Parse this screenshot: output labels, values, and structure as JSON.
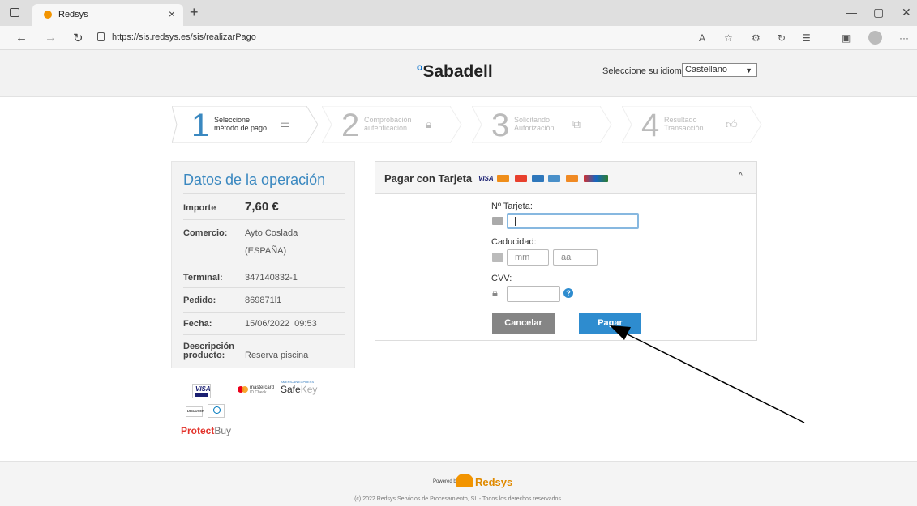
{
  "browser": {
    "tab_title": "Redsys",
    "tab_close": "×",
    "new_tab": "+",
    "url": "https://sis.redsys.es/sis/realizarPago",
    "read_aloud": "A̅",
    "window": {
      "minimize": "—",
      "restore": "▢",
      "close": "✕"
    }
  },
  "header": {
    "logo_mark": "o",
    "logo": "Sabadell",
    "language_label": "Seleccione su idioma",
    "language_value": "Castellano"
  },
  "steps": [
    {
      "number": "1",
      "line1": "Seleccione",
      "line2": "método de pago"
    },
    {
      "number": "2",
      "line1": "Comprobación",
      "line2": "autenticación"
    },
    {
      "number": "3",
      "line1": "Solicitando",
      "line2": "Autorización"
    },
    {
      "number": "4",
      "line1": "Resultado",
      "line2": "Transacción"
    }
  ],
  "operation": {
    "title": "Datos de la operación",
    "rows": [
      {
        "key": "Importe",
        "value": "7,60 €"
      },
      {
        "key": "Comercio:",
        "value": "Ayto Coslada",
        "value2": "(ESPAÑA)"
      },
      {
        "key": "Terminal:",
        "value": "347140832-1"
      },
      {
        "key": "Pedido:",
        "value": "869871l1"
      },
      {
        "key": "Fecha:",
        "value": "15/06/2022  09:53"
      },
      {
        "key": "Descripción",
        "key2": "producto:",
        "value": "Reserva piscina"
      }
    ]
  },
  "brands": {
    "visa": "VISA",
    "mastercard": "mastercard",
    "mastercard_sub": "ID Check",
    "amex": "AMERICAN EXPRESS",
    "safekey_1": "Safe",
    "safekey_2": "Key",
    "discover": "DISCOVER",
    "protectbuy_1": "Protect",
    "protectbuy_2": "Buy"
  },
  "card_form": {
    "title": "Pagar con Tarjeta",
    "visa_chip": "VISA",
    "card_number_label": "Nº Tarjeta:",
    "expiry_label": "Caducidad:",
    "month_placeholder": "mm",
    "year_placeholder": "aa",
    "cvv_label": "CVV:",
    "help": "?",
    "cancel": "Cancelar",
    "pay": "Pagar",
    "collapse": "^"
  },
  "footer": {
    "powered_by": "Powered by",
    "redsys": "Redsys",
    "copyright": "(c) 2022 Redsys Servicios de Procesamiento, SL - Todos los derechos reservados."
  },
  "colors": {
    "accent_blue": "#2e8ccf",
    "cancel_grey": "#858585",
    "redsys_orange": "#f29400"
  }
}
